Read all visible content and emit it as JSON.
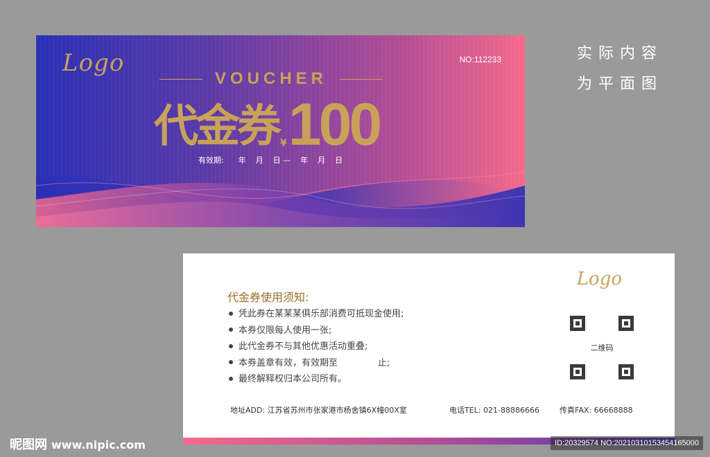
{
  "front": {
    "logo": "Logo",
    "serial": "NO:112233",
    "voucher_en": "VOUCHER",
    "title_cn": "代金券",
    "currency": "¥",
    "amount": "100",
    "validity": "有效期:      年    月    日 —    年    月    日"
  },
  "side_note": {
    "line1": "实际内容",
    "line2": "为平面图"
  },
  "back": {
    "logo": "Logo",
    "notice_title": "代金券使用须知:",
    "rules": [
      "凭此券在某某某俱乐部消费可抵现金使用;",
      "本券仅限每人使用一张;",
      "此代金券不与其他优惠活动重叠;",
      "本券盖章有效，有效期至              止;",
      "最终解释权归本公司所有。"
    ],
    "qr_label": "二维码",
    "address": "地址ADD: 江苏省苏州市张家港市杨舍镇6X幢00X室",
    "phone": "电话TEL: 021-88886666",
    "fax": "传真FAX: 66668888"
  },
  "watermark": {
    "brand": "昵图网",
    "site": "www.nipic.com",
    "id": "ID:20329574 NO:20210310153454165000"
  },
  "colors": {
    "gold": "#c9a25a",
    "gradient_start": "#2a2fb6",
    "gradient_end": "#f46a8a",
    "background": "#9a9a9a"
  }
}
